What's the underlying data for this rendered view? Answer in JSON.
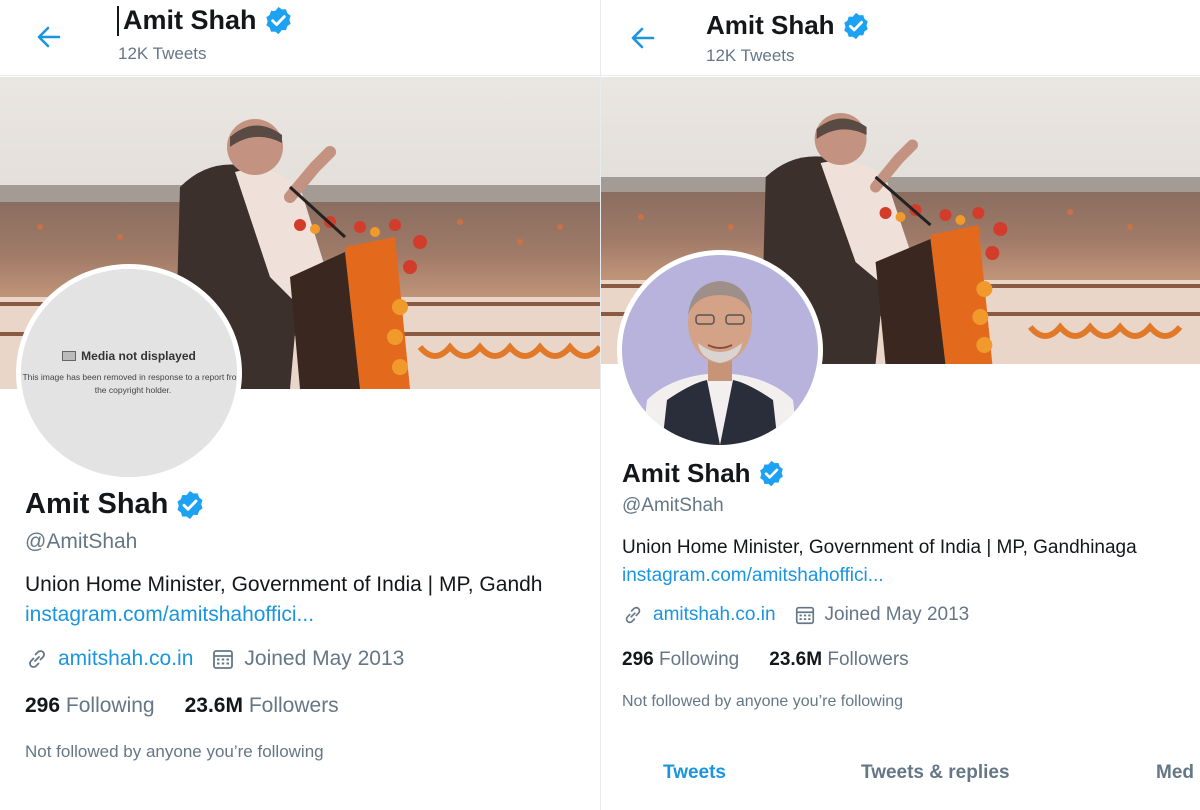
{
  "left_panel": {
    "header": {
      "title": "Amit Shah",
      "tweet_count": "12K Tweets"
    },
    "avatar_placeholder": {
      "title": "Media not displayed",
      "description": "This image has been removed in response to a report from the copyright holder."
    },
    "profile": {
      "name": "Amit Shah",
      "handle": "@AmitShah",
      "bio": "Union Home Minister, Government of India | MP, Gandh",
      "bio_link": "instagram.com/amitshahoffici...",
      "website": "amitshah.co.in",
      "joined": "Joined May 2013",
      "following_count": "296",
      "following_label": "Following",
      "followers_count": "23.6M",
      "followers_label": "Followers",
      "not_followed": "Not followed by anyone you’re following"
    }
  },
  "right_panel": {
    "header": {
      "title": "Amit Shah",
      "tweet_count": "12K Tweets"
    },
    "profile": {
      "name": "Amit Shah",
      "handle": "@AmitShah",
      "bio": "Union Home Minister, Government of India | MP, Gandhinaga",
      "bio_link": "instagram.com/amitshahoffici...",
      "website": "amitshah.co.in",
      "joined": "Joined May 2013",
      "following_count": "296",
      "following_label": "Following",
      "followers_count": "23.6M",
      "followers_label": "Followers",
      "not_followed": "Not followed by anyone you’re following"
    },
    "tabs": [
      "Tweets",
      "Tweets & replies",
      "Med"
    ]
  },
  "icons": {
    "back": "arrow-left-icon",
    "verified": "verified-badge-icon",
    "link": "link-icon",
    "calendar": "calendar-icon"
  },
  "colors": {
    "accent": "#1b95e0",
    "verified": "#1da1f2",
    "secondary_text": "#657786",
    "primary_text": "#14171a",
    "border": "#e6ecf0"
  }
}
